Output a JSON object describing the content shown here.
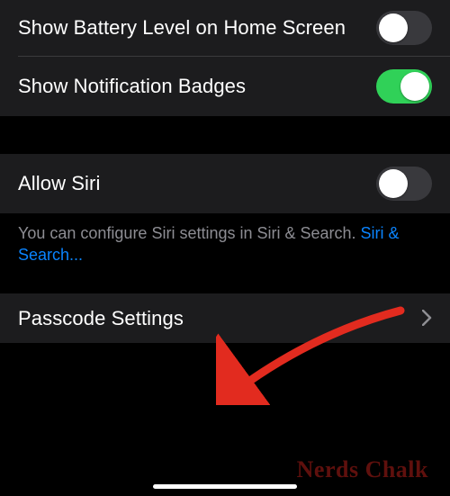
{
  "rows": {
    "battery": {
      "label": "Show Battery Level on Home Screen",
      "on": false
    },
    "badges": {
      "label": "Show Notification Badges",
      "on": true
    },
    "siri": {
      "label": "Allow Siri",
      "on": false
    },
    "passcode": {
      "label": "Passcode Settings"
    }
  },
  "siri_note": {
    "text": "You can configure Siri settings in Siri & Search. ",
    "link": "Siri & Search..."
  },
  "watermark": "Nerds Chalk"
}
